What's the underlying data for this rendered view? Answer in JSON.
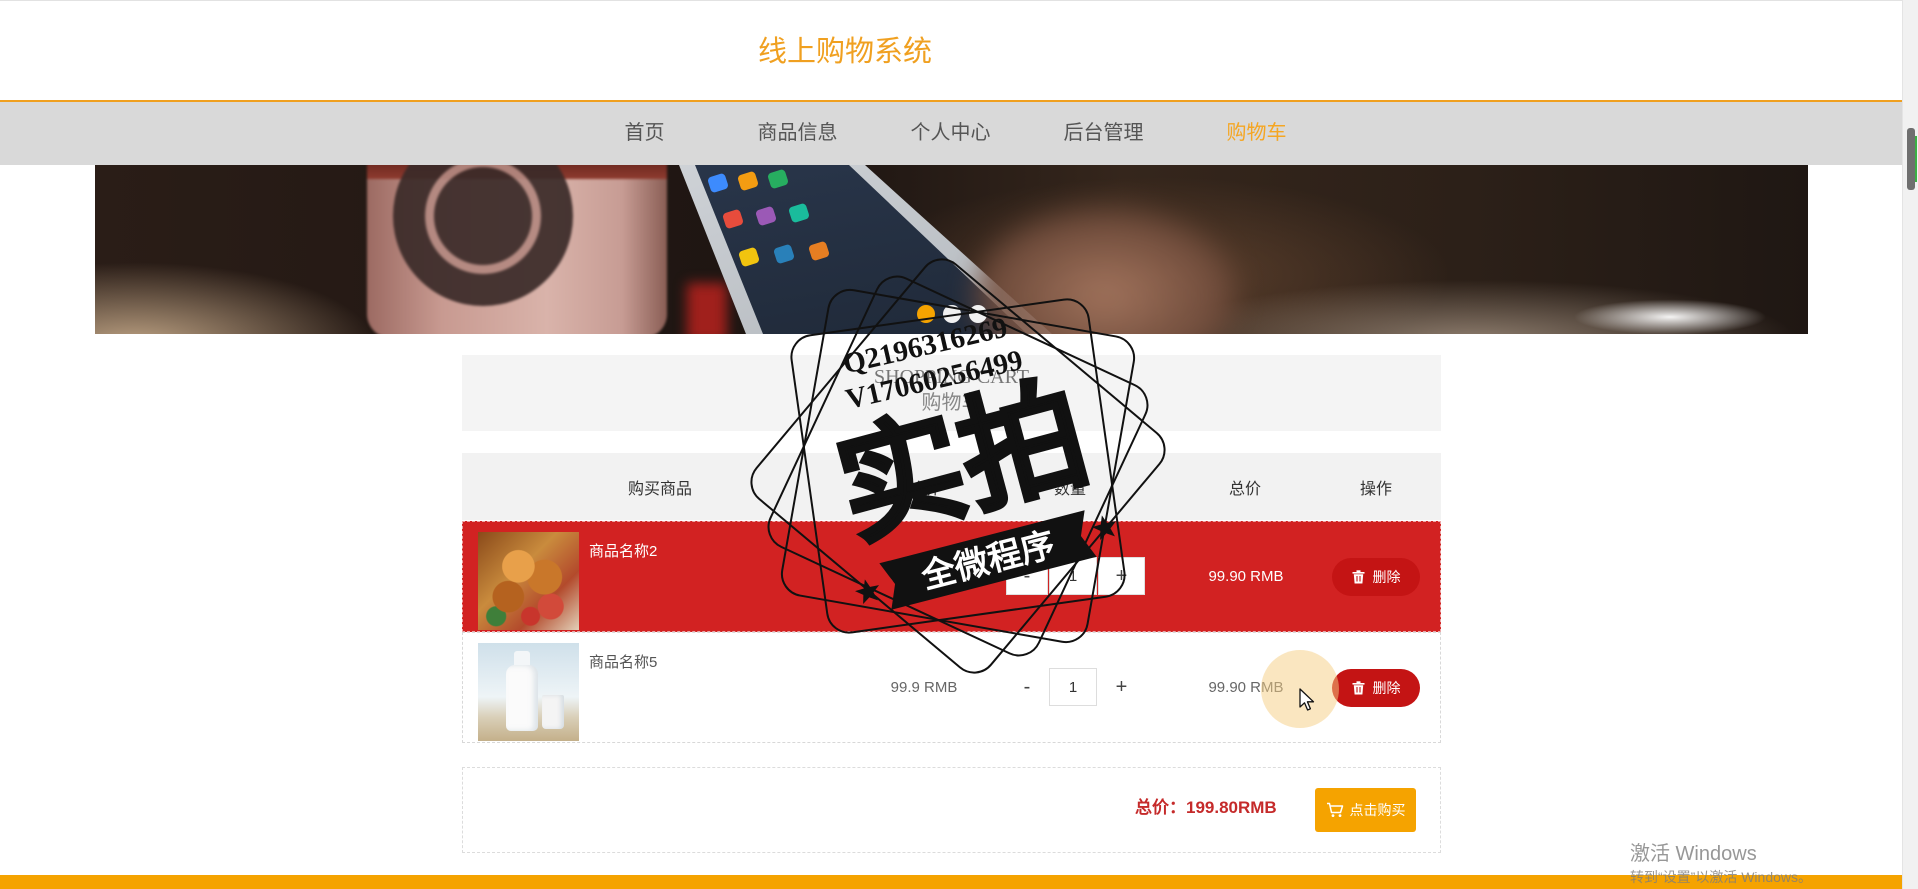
{
  "app": {
    "title": "线上购物系统"
  },
  "nav": {
    "items": [
      {
        "label": "首页",
        "active": false
      },
      {
        "label": "商品信息",
        "active": false
      },
      {
        "label": "个人中心",
        "active": false
      },
      {
        "label": "后台管理",
        "active": false
      },
      {
        "label": "购物车",
        "active": true
      }
    ]
  },
  "carousel": {
    "slide_count": 3,
    "active_index": 0
  },
  "cart": {
    "title_en": "SHOPPING CART",
    "title_cn": "购物车",
    "columns": [
      "购买商品",
      "单价",
      "数量",
      "总价",
      "操作"
    ],
    "qty_minus": "-",
    "qty_plus": "+",
    "items": [
      {
        "name": "商品名称2",
        "image": "fried-chicken-photo",
        "unit_price": "99.9 RMB",
        "quantity": "1",
        "total": "99.90 RMB",
        "delete_label": "删除",
        "highlighted": true
      },
      {
        "name": "商品名称5",
        "image": "milk-bottle-photo",
        "unit_price": "99.9 RMB",
        "quantity": "1",
        "total": "99.90 RMB",
        "delete_label": "删除",
        "highlighted": false
      }
    ],
    "summary_label": "总价：",
    "summary_value": "199.80RMB",
    "buy_label": "点击购买"
  },
  "watermark": {
    "big_text": "实拍",
    "ribbon_text": "全微程序",
    "contact_q": "Q2196316269",
    "contact_v": "V17060256499"
  },
  "os_notice": {
    "line1": "激活 Windows",
    "line2": "转到“设置”以激活 Windows。"
  },
  "icons": {
    "delete": "trash-icon",
    "buy": "cart-icon",
    "pointer": "arrow-cursor-icon"
  },
  "colors": {
    "accent": "#f0a020",
    "nav_active": "#f5a623",
    "nav_bg": "#d9d9d9",
    "highlight_row": "#d22222",
    "delete_button": "#c41414",
    "total_price": "#c52a2a",
    "buy_button": "#f5a300"
  }
}
